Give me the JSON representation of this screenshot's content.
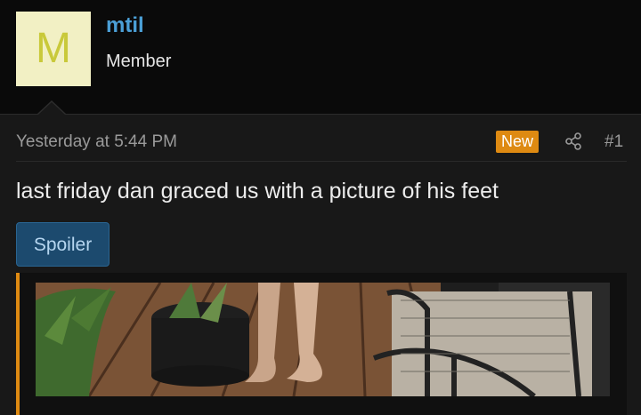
{
  "user": {
    "avatar_letter": "M",
    "name": "mtil",
    "title": "Member",
    "avatar_bg": "#f2f0c4",
    "avatar_fg": "#c9c93a",
    "name_color": "#4b9fd6"
  },
  "post": {
    "timestamp": "Yesterday at 5:44 PM",
    "badge": "New",
    "badge_color": "#de8a12",
    "share_icon": "share-icon",
    "number": "#1",
    "message": "last friday dan graced us with a picture of his feet",
    "spoiler_label": "Spoiler",
    "image_alt": "photo of bare feet on a wooden deck next to potted plants and a patio chair"
  }
}
